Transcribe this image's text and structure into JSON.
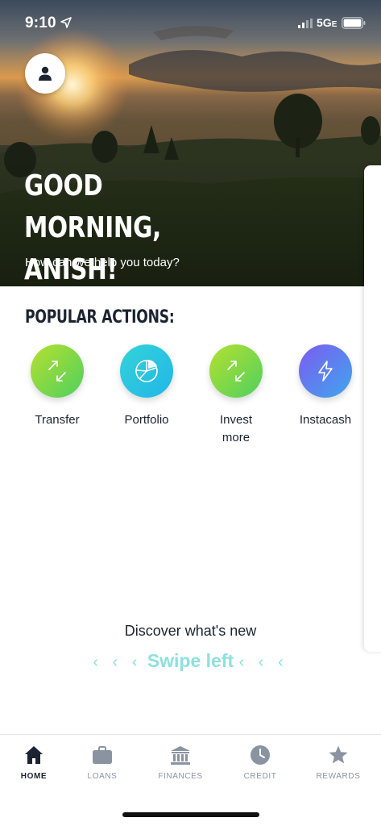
{
  "status_bar": {
    "time": "9:10",
    "network": "5G",
    "network_suffix": "E"
  },
  "hero": {
    "greeting_line1": "GOOD MORNING,",
    "greeting_line2": "ANISH!",
    "subtitle": "How can we help you today?"
  },
  "popular_actions": {
    "title": "POPULAR ACTIONS:",
    "items": [
      {
        "label": "Transfer",
        "icon": "transfer-arrows-icon"
      },
      {
        "label": "Portfolio",
        "icon": "pie-chart-icon"
      },
      {
        "label": "Invest",
        "label2": "more",
        "icon": "transfer-arrows-icon"
      },
      {
        "label": "Instacash",
        "icon": "lightning-icon"
      }
    ]
  },
  "discover": {
    "title": "Discover what's new",
    "swipe_text": "Swipe left",
    "chevrons": "‹ ‹ ‹"
  },
  "tab_bar": {
    "items": [
      {
        "label": "HOME",
        "icon": "home-icon",
        "active": true
      },
      {
        "label": "LOANS",
        "icon": "briefcase-icon",
        "active": false
      },
      {
        "label": "FINANCES",
        "icon": "bank-icon",
        "active": false
      },
      {
        "label": "CREDIT",
        "icon": "clock-icon",
        "active": false
      },
      {
        "label": "REWARDS",
        "icon": "star-icon",
        "active": false
      }
    ]
  },
  "colors": {
    "primary_text": "#1c2331",
    "inactive_tab": "#8a94a1",
    "swipe_accent": "#8fe0dc"
  }
}
